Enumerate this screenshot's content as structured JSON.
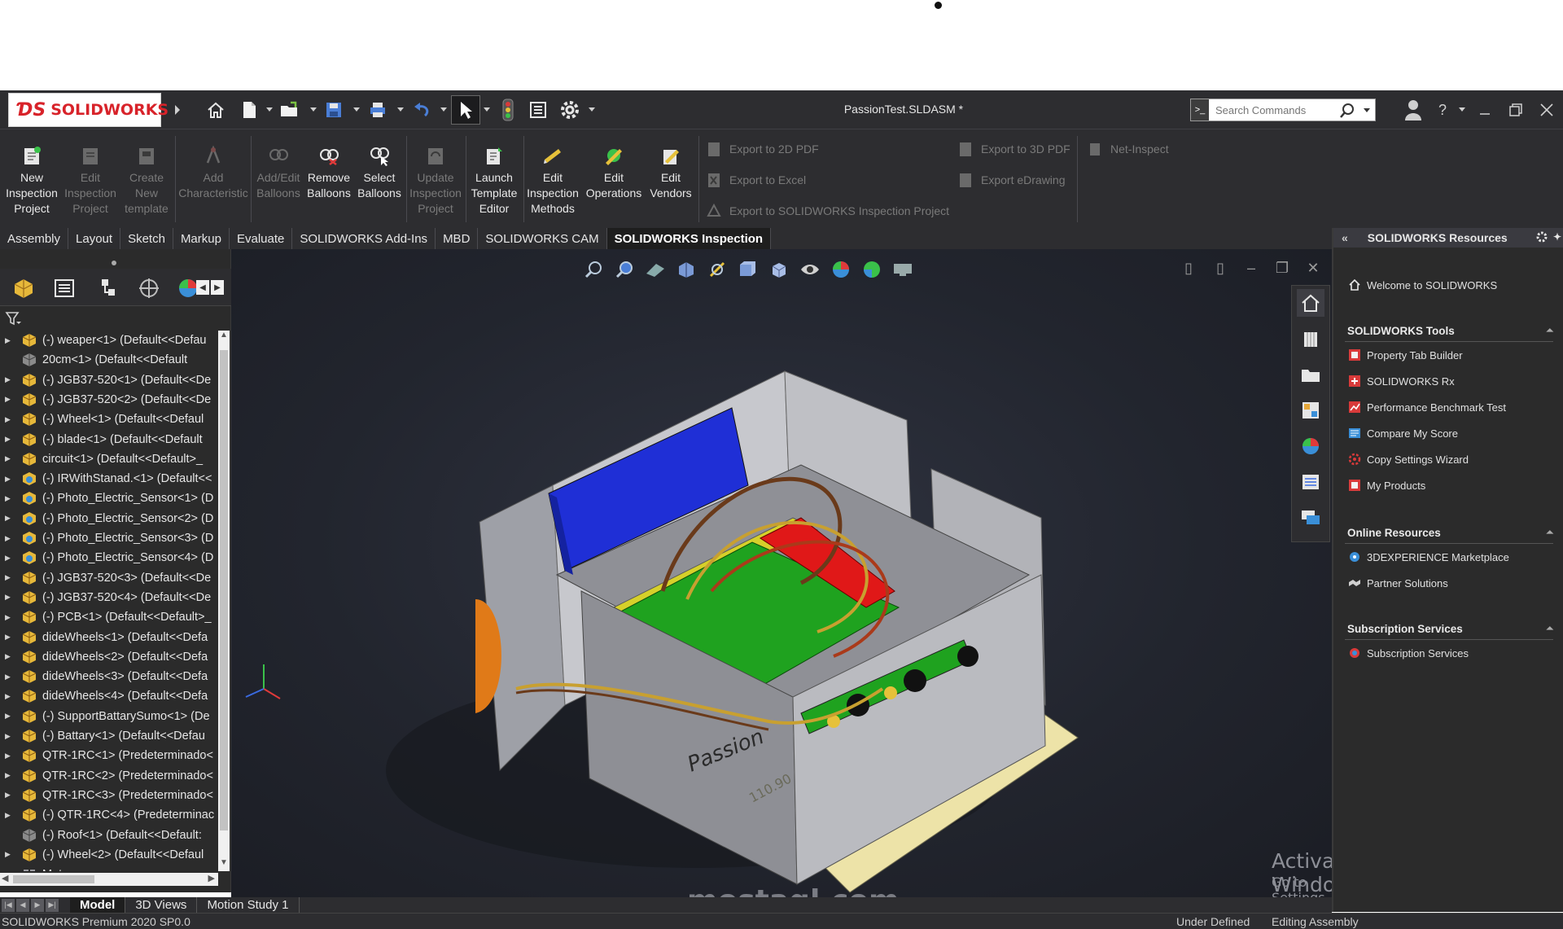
{
  "app": {
    "brand": "SOLIDWORKS",
    "doc_title": "PassionTest.SLDASM *"
  },
  "search": {
    "placeholder": "Search Commands"
  },
  "ribbon": {
    "buttons": [
      {
        "label": "New\nInspection\nProject",
        "enabled": true
      },
      {
        "label": "Edit\nInspection\nProject",
        "enabled": false
      },
      {
        "label": "Create\nNew\ntemplate",
        "enabled": false
      },
      {
        "label": "Add\nCharacteristic",
        "enabled": false
      },
      {
        "label": "Add/Edit\nBalloons",
        "enabled": false
      },
      {
        "label": "Remove\nBalloons",
        "enabled": true
      },
      {
        "label": "Select\nBalloons",
        "enabled": true
      },
      {
        "label": "Update\nInspection\nProject",
        "enabled": false
      },
      {
        "label": "Launch\nTemplate\nEditor",
        "enabled": true
      },
      {
        "label": "Edit\nInspection\nMethods",
        "enabled": true
      },
      {
        "label": "Edit\nOperations",
        "enabled": true
      },
      {
        "label": "Edit\nVendors",
        "enabled": true
      }
    ],
    "export": {
      "pdf2d": "Export to 2D PDF",
      "excel": "Export to Excel",
      "sw_project": "Export to SOLIDWORKS Inspection Project",
      "pdf3d": "Export to 3D PDF",
      "edrawing": "Export eDrawing",
      "net_inspect": "Net-Inspect"
    }
  },
  "tabs": [
    "Assembly",
    "Layout",
    "Sketch",
    "Markup",
    "Evaluate",
    "SOLIDWORKS Add-Ins",
    "MBD",
    "SOLIDWORKS CAM",
    "SOLIDWORKS Inspection"
  ],
  "active_tab": "SOLIDWORKS Inspection",
  "tree": {
    "items": [
      {
        "label": "(-) weaper<1> (Default<<Defau",
        "expand": true,
        "icon": "part"
      },
      {
        "label": "20cm<1> (Default<<Default",
        "expand": false,
        "icon": "part-grey"
      },
      {
        "label": "(-) JGB37-520<1> (Default<<De",
        "expand": true,
        "icon": "part"
      },
      {
        "label": "(-) JGB37-520<2> (Default<<De",
        "expand": true,
        "icon": "part"
      },
      {
        "label": "(-) Wheel<1> (Default<<Defaul",
        "expand": true,
        "icon": "part"
      },
      {
        "label": "(-) blade<1> (Default<<Default",
        "expand": true,
        "icon": "part"
      },
      {
        "label": "circuit<1> (Default<<Default>_",
        "expand": true,
        "icon": "part"
      },
      {
        "label": "(-) IRWithStanad.<1> (Default<<",
        "expand": true,
        "icon": "part-blue"
      },
      {
        "label": "(-) Photo_Electric_Sensor<1> (D",
        "expand": true,
        "icon": "part-blue"
      },
      {
        "label": "(-) Photo_Electric_Sensor<2> (D",
        "expand": true,
        "icon": "part-blue"
      },
      {
        "label": "(-) Photo_Electric_Sensor<3> (D",
        "expand": true,
        "icon": "part-blue"
      },
      {
        "label": "(-) Photo_Electric_Sensor<4> (D",
        "expand": true,
        "icon": "part-blue"
      },
      {
        "label": "(-) JGB37-520<3> (Default<<De",
        "expand": true,
        "icon": "part"
      },
      {
        "label": "(-) JGB37-520<4> (Default<<De",
        "expand": true,
        "icon": "part"
      },
      {
        "label": "(-) PCB<1> (Default<<Default>_",
        "expand": true,
        "icon": "part"
      },
      {
        "label": "dideWheels<1> (Default<<Defa",
        "expand": true,
        "icon": "part"
      },
      {
        "label": "dideWheels<2> (Default<<Defa",
        "expand": true,
        "icon": "part"
      },
      {
        "label": "dideWheels<3> (Default<<Defa",
        "expand": true,
        "icon": "part"
      },
      {
        "label": "dideWheels<4> (Default<<Defa",
        "expand": true,
        "icon": "part"
      },
      {
        "label": "(-) SupportBattarySumo<1> (De",
        "expand": true,
        "icon": "part"
      },
      {
        "label": "(-) Battary<1> (Default<<Defau",
        "expand": true,
        "icon": "part"
      },
      {
        "label": "QTR-1RC<1> (Predeterminado<",
        "expand": true,
        "icon": "part"
      },
      {
        "label": "QTR-1RC<2> (Predeterminado<",
        "expand": true,
        "icon": "part"
      },
      {
        "label": "QTR-1RC<3> (Predeterminado<",
        "expand": true,
        "icon": "part"
      },
      {
        "label": "(-) QTR-1RC<4> (Predeterminac",
        "expand": true,
        "icon": "part"
      },
      {
        "label": "(-) Roof<1> (Default<<Default:",
        "expand": false,
        "icon": "part-grey"
      },
      {
        "label": "(-) Wheel<2> (Default<<Defaul",
        "expand": true,
        "icon": "part"
      },
      {
        "label": "Mates",
        "expand": false,
        "icon": "mates"
      }
    ]
  },
  "resources": {
    "header": "SOLIDWORKS Resources",
    "welcome": "Welcome to SOLIDWORKS",
    "tools_title": "SOLIDWORKS Tools",
    "tools": [
      "Property Tab Builder",
      "SOLIDWORKS Rx",
      "Performance Benchmark Test",
      "Compare My Score",
      "Copy Settings Wizard",
      "My Products"
    ],
    "online_title": "Online Resources",
    "online": [
      "3DEXPERIENCE Marketplace",
      "Partner Solutions"
    ],
    "subs_title": "Subscription Services",
    "subs": [
      "Subscription Services"
    ]
  },
  "model_texts": {
    "label": "Passion",
    "dimension": "110.90"
  },
  "watermark": {
    "line1": "Activate Windows",
    "line2": "Go to Settings to activate Windows.",
    "site": "mostaql.com"
  },
  "bottom_tabs": [
    "Model",
    "3D Views",
    "Motion Study 1"
  ],
  "status": {
    "version": "SOLIDWORKS Premium 2020 SP0.0",
    "state": "Under Defined",
    "mode": "Editing Assembly"
  },
  "colors": {
    "accent_red": "#d8232a",
    "background": "#2d2d30",
    "model_blue": "#1f2fd6",
    "model_green": "#1fa21f"
  }
}
